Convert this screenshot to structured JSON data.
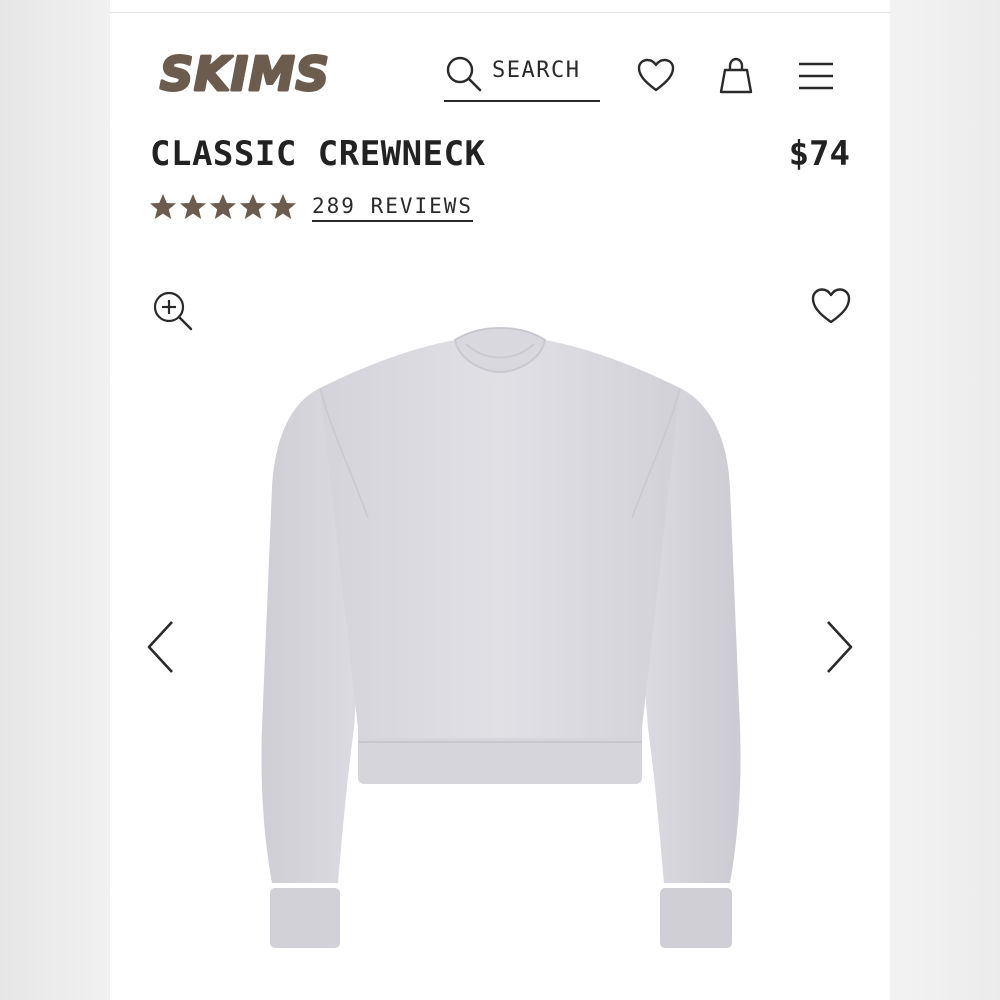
{
  "header": {
    "brand": "SKIMS",
    "search_label": "SEARCH",
    "icons": {
      "search": "search-icon",
      "wishlist": "heart-icon",
      "bag": "shopping-bag-icon",
      "menu": "hamburger-menu-icon"
    }
  },
  "product": {
    "title": "CLASSIC CREWNECK",
    "price": "$74",
    "rating": 5,
    "rating_max": 5,
    "reviews_label": "289 REVIEWS",
    "image_alt": "heather grey crewneck sweatshirt"
  },
  "gallery": {
    "zoom_icon": "zoom-in-icon",
    "wishlist_icon": "heart-icon",
    "prev_icon": "chevron-left-icon",
    "next_icon": "chevron-right-icon"
  },
  "colors": {
    "brand": "#6b5c4e",
    "text": "#222222",
    "garment": "#dcdbe0"
  }
}
